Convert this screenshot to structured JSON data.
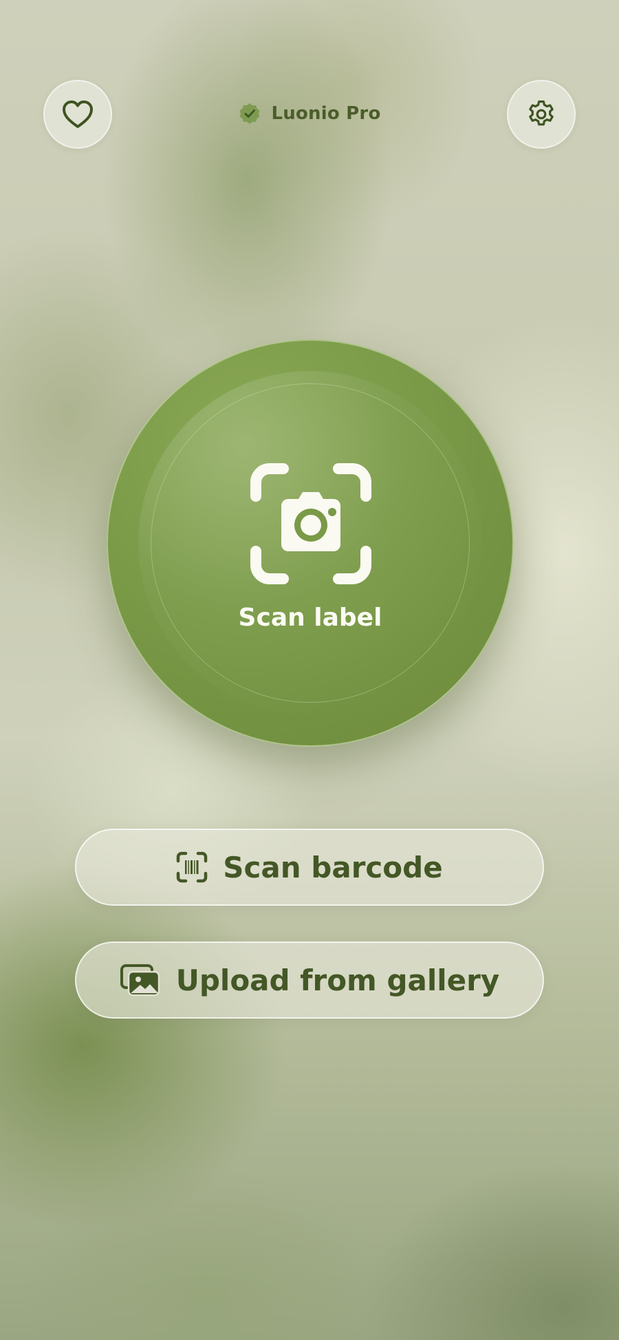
{
  "header": {
    "brand_name": "Luonio Pro",
    "favorites_icon": "heart-icon",
    "settings_icon": "gear-icon",
    "badge_icon": "verified-badge-icon"
  },
  "main": {
    "scan_label": "Scan label",
    "scan_icon": "camera-viewfinder-icon"
  },
  "actions": {
    "barcode_label": "Scan barcode",
    "barcode_icon": "barcode-viewfinder-icon",
    "gallery_label": "Upload from gallery",
    "gallery_icon": "photo-gallery-icon"
  },
  "colors": {
    "accent_green": "#7a9a48",
    "text_dark_green": "#445726",
    "on_accent_text": "#fbfaf2"
  }
}
